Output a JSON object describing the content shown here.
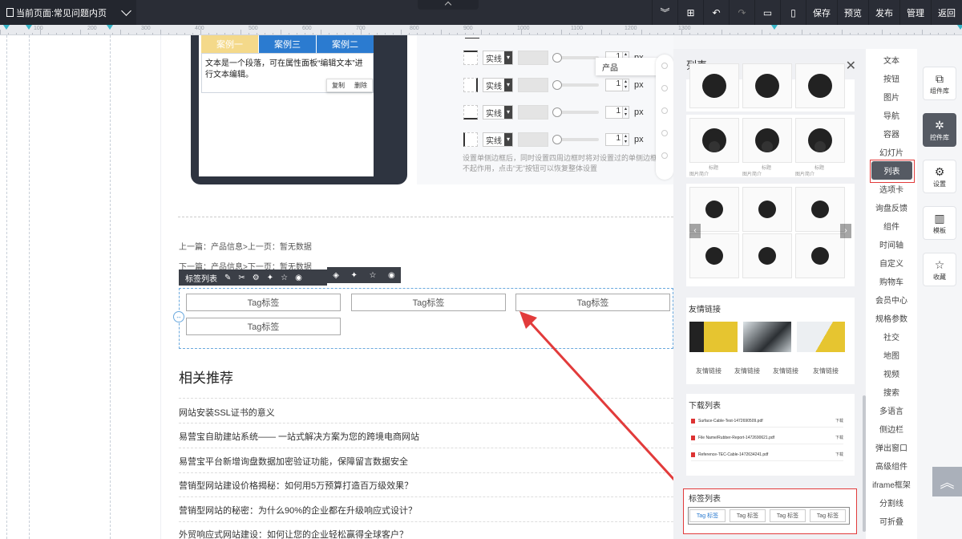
{
  "topbar": {
    "page_label": "当前页面:常见问题内页",
    "save": "保存",
    "preview": "预览",
    "publish": "发布",
    "manage": "管理",
    "back": "返回"
  },
  "ruler": {
    "numbers": [
      "100",
      "200",
      "300",
      "400",
      "500",
      "600",
      "700",
      "800",
      "900",
      "1000",
      "1100",
      "1200",
      "1300"
    ]
  },
  "canvas": {
    "tabs": [
      "案例一",
      "案例三",
      "案例二"
    ],
    "paragraph": "文本是一个段落，可在属性面板“编辑文本”进行文本编辑。",
    "copy": "复制",
    "delete": "删除",
    "border_rows": [
      {
        "style": "实线",
        "value": "1",
        "unit": "px"
      },
      {
        "style": "实线",
        "value": "1",
        "unit": "px"
      },
      {
        "style": "实线",
        "value": "1",
        "unit": "px"
      },
      {
        "style": "实线",
        "value": "1",
        "unit": "px"
      }
    ],
    "border_note": "设置单侧边框后，同时设置四周边框时将对设置过的单侧边框不起作用，点击“无”按钮可以恢复整体设置",
    "tooltip": "产品",
    "prev": "上一篇：产品信息>上一页：暂无数据",
    "next": "下一篇：产品信息>下一页：暂无数据",
    "tag_toolbar_label": "标签列表",
    "tags": [
      "Tag标签",
      "Tag标签",
      "Tag标签",
      "Tag标签"
    ],
    "rec_title": "相关推荐",
    "rec_items": [
      "网站安装SSL证书的意义",
      "易营宝自助建站系统—— 一站式解决方案为您的跨境电商网站",
      "易营宝平台新增询盘数据加密验证功能，保障留言数据安全",
      "营销型网站建设价格揭秘：如何用5万预算打造百万级效果？",
      "营销型网站的秘密：为什么90%的企业都在升级响应式设计？",
      "外贸响应式网站建设：如何让您的企业轻松赢得全球客户？"
    ]
  },
  "panel": {
    "title": "列表",
    "product_label": "标题",
    "product_sub": "图片简介",
    "links_title": "友情链接",
    "links": [
      "友情链接",
      "友情链接",
      "友情链接",
      "友情链接"
    ],
    "download_title": "下载列表",
    "downloads": [
      {
        "name": "Surface-Cable-Test-1472690509.pdf",
        "action": "下载"
      },
      {
        "name": "File Name/Rubber-Report-1472690621.pdf",
        "action": "下载"
      },
      {
        "name": "Reference-TEC-Cable-1472634241.pdf",
        "action": "下载"
      }
    ],
    "taglist_title": "标签列表",
    "mini_tags": [
      "Tag 标签",
      "Tag 标签",
      "Tag 标签",
      "Tag 标签"
    ]
  },
  "categories": [
    "文本",
    "按钮",
    "图片",
    "导航",
    "容器",
    "幻灯片",
    "列表",
    "选项卡",
    "询盘反馈",
    "组件",
    "时间轴",
    "自定义",
    "购物车",
    "会员中心",
    "规格参数",
    "社交",
    "地图",
    "视频",
    "搜索",
    "多语言",
    "侧边栏",
    "弹出窗口",
    "高级组件",
    "iframe框架",
    "分割线",
    "可折叠"
  ],
  "active_category": "列表",
  "sidebar": [
    {
      "label": "组件库",
      "icon": "⧉"
    },
    {
      "label": "控件库",
      "icon": "✲"
    },
    {
      "label": "设置",
      "icon": "⚙"
    },
    {
      "label": "模板",
      "icon": "▥"
    },
    {
      "label": "收藏",
      "icon": "☆"
    }
  ],
  "colors": {
    "accent_red": "#e23b3b",
    "tab_blue": "#2b7bd0",
    "tab_yellow": "#f4d98a",
    "dark": "#2a2d36"
  }
}
